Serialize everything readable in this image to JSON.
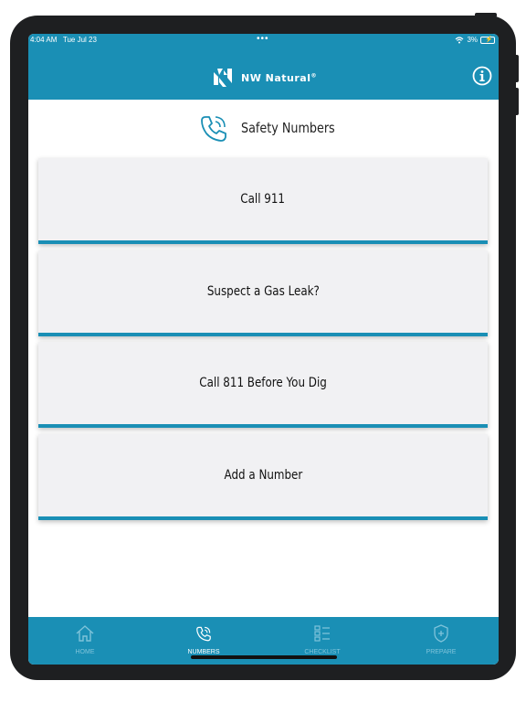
{
  "status_bar": {
    "time": "4:04 AM",
    "date": "Tue Jul 23",
    "battery": "3%"
  },
  "header": {
    "brand": "NW Natural",
    "brand_mark": "®",
    "info_icon": "info-icon"
  },
  "page": {
    "title": "Safety Numbers",
    "icon": "phone-icon"
  },
  "cards": [
    {
      "label": "Call 911"
    },
    {
      "label": "Suspect a Gas Leak?"
    },
    {
      "label": "Call 811 Before You Dig"
    },
    {
      "label": "Add a Number"
    }
  ],
  "tabs": [
    {
      "label": "HOME",
      "icon": "home-icon",
      "active": false
    },
    {
      "label": "NUMBERS",
      "icon": "phone-icon",
      "active": true
    },
    {
      "label": "CHECKLIST",
      "icon": "checklist-icon",
      "active": false
    },
    {
      "label": "PREPARE",
      "icon": "shield-icon",
      "active": false
    }
  ],
  "colors": {
    "brand": "#1a8fb5",
    "card_bg": "#f1f1f3",
    "inactive_tab": "#7fc3da"
  }
}
